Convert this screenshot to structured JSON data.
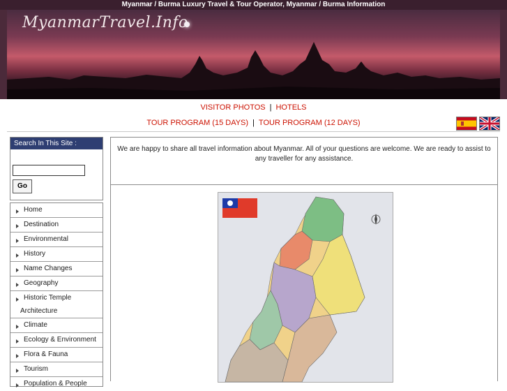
{
  "top_bar": {
    "text": "Myanmar / Burma Luxury Travel & Tour Operator, Myanmar / Burma Information"
  },
  "banner": {
    "title": "MyanmarTravel.Info"
  },
  "nav": {
    "row1": [
      "VISITOR PHOTOS",
      "HOTELS"
    ],
    "row2": [
      "TOUR PROGRAM (15 DAYS)",
      "TOUR PROGRAM (12 DAYS)"
    ],
    "separator": "|",
    "flags": [
      "spanish-flag-icon",
      "uk-flag-icon"
    ]
  },
  "search": {
    "heading": "Search In This Site :",
    "value": "",
    "button": "Go"
  },
  "menu": [
    {
      "label": "Home"
    },
    {
      "label": "Destination"
    },
    {
      "label": "Environmental"
    },
    {
      "label": "History"
    },
    {
      "label": "Name Changes"
    },
    {
      "label": "Geography"
    },
    {
      "label": "Historic Temple",
      "label2": "Architecture"
    },
    {
      "label": "Climate"
    },
    {
      "label": "Ecology & Environment"
    },
    {
      "label": "Flora & Fauna"
    },
    {
      "label": "Tourism"
    },
    {
      "label": "Population & People"
    }
  ],
  "main": {
    "intro": "We are happy to share all travel information about Myanmar. All of your questions are welcome. We are ready to assist to any traveller for any assistance.",
    "map_icon": "myanmar-map"
  },
  "colors": {
    "top_bar": "#3a1f2e",
    "nav_link": "#cc1100",
    "search_head": "#2e3e72"
  }
}
